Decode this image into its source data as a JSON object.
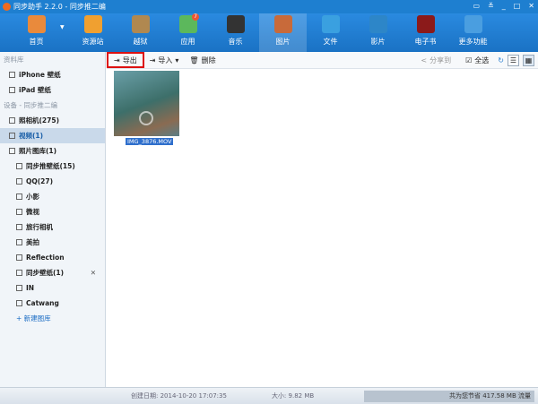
{
  "title": "同步助手 2.2.0 - 同步推二编",
  "nav": [
    {
      "label": "首页",
      "color": "#e98a3c"
    },
    {
      "label": "资源站",
      "color": "#f0a030"
    },
    {
      "label": "越狱",
      "color": "#b08850"
    },
    {
      "label": "应用",
      "color": "#5cb85c",
      "badge": "7"
    },
    {
      "label": "音乐",
      "color": "#333"
    },
    {
      "label": "图片",
      "color": "#c86a3a",
      "active": true
    },
    {
      "label": "文件",
      "color": "#3aa0e0"
    },
    {
      "label": "影片",
      "color": "#2d86c8"
    },
    {
      "label": "电子书",
      "color": "#8b1a1a"
    },
    {
      "label": "更多功能",
      "color": "#4a9ee0"
    }
  ],
  "sidebar": {
    "library_head": "资料库",
    "iphone": "iPhone 壁纸",
    "ipad": "iPad 壁纸",
    "device_head": "设备 - 同步推二编",
    "camera": "照相机(275)",
    "video": "视频(1)",
    "photolib": "照片图库(1)",
    "subs": [
      "同步推壁纸(15)",
      "QQ(27)",
      "小影",
      "微视",
      "旅行相机",
      "美拍",
      "Reflection",
      "同步壁纸(1)",
      "IN",
      "Catwang"
    ],
    "new_album": "+ 新建图库"
  },
  "toolbar": {
    "export": "导出",
    "import": "导入",
    "delete": "删除",
    "share": "分享到",
    "select_all": "全选"
  },
  "file": {
    "name": "IMG_3876.MOV"
  },
  "status": {
    "created": "创建日期: 2014-10-20 17:07:35",
    "size": "大小:  9.82 MB",
    "saved": "共为您节省 417.58 MB 流量"
  }
}
